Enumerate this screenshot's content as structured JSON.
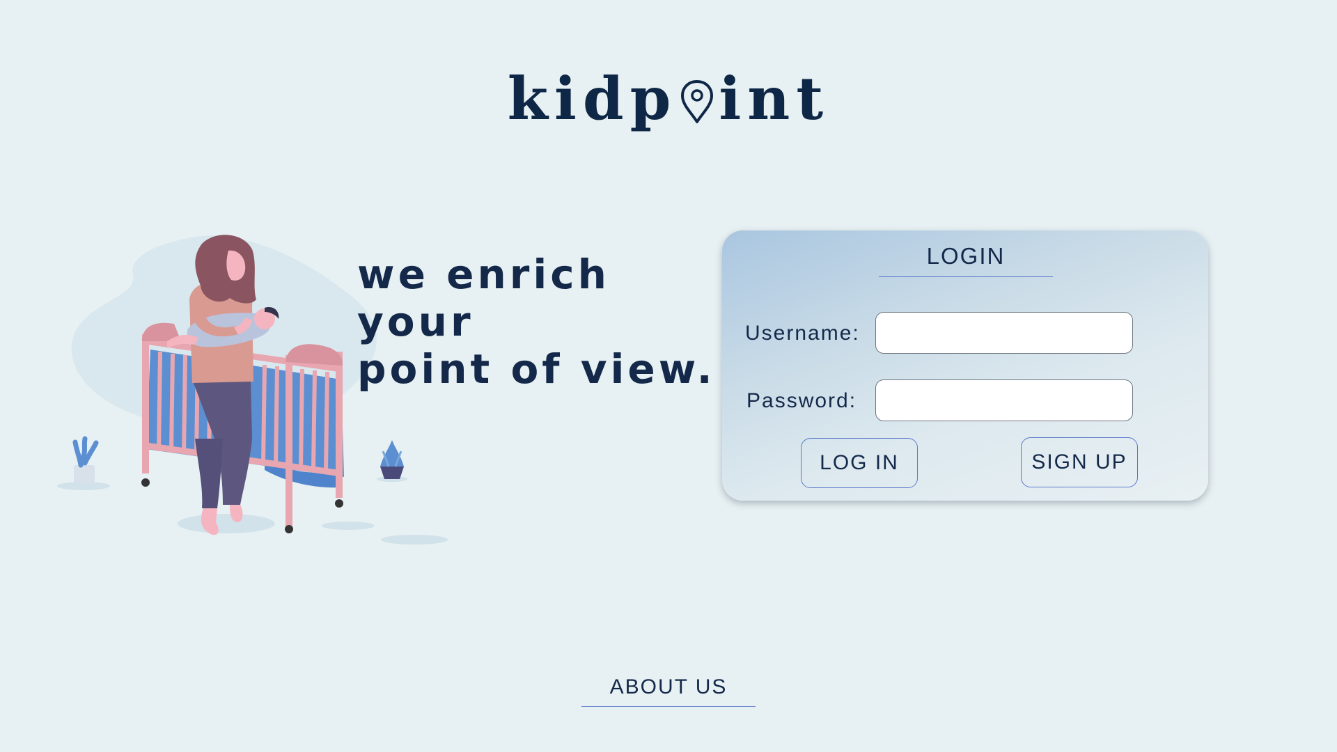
{
  "brand": {
    "logo_prefix": "kidp",
    "logo_suffix": "int",
    "logo_icon": "map-pin-icon"
  },
  "hero": {
    "tagline_lines": [
      "we enrich",
      "your",
      "point of view."
    ],
    "illustration": "mother-holding-baby-by-crib-illustration"
  },
  "login": {
    "title": "LOGIN",
    "username_label": "Username:",
    "username_value": "",
    "password_label": "Password:",
    "password_value": "",
    "login_button": "LOG IN",
    "signup_button": "SIGN UP"
  },
  "footer": {
    "about_us": "ABOUT US"
  },
  "colors": {
    "background": "#e7f0f2",
    "text_primary": "#14294a",
    "accent_border": "#5b78c9",
    "card_gradient_start": "#a9c6e0",
    "card_gradient_end": "#e8f0f3"
  }
}
